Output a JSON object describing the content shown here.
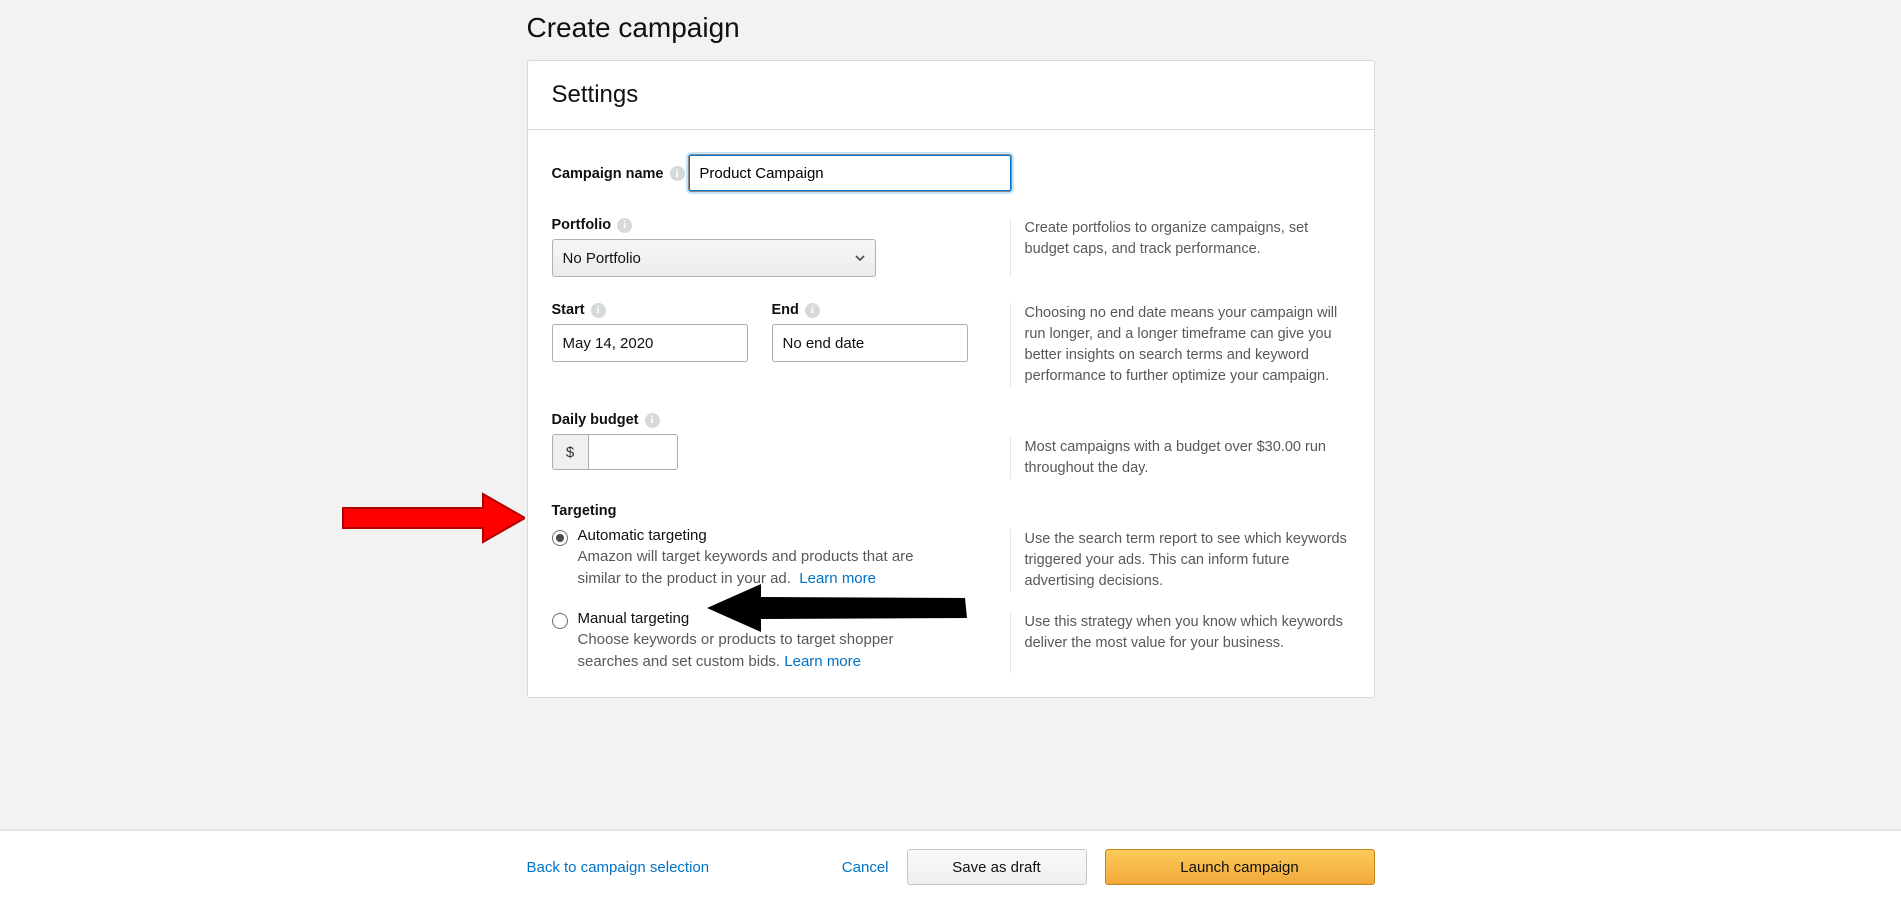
{
  "page": {
    "title": "Create campaign"
  },
  "settings": {
    "heading": "Settings",
    "campaign_name": {
      "label": "Campaign name",
      "value": "Product Campaign"
    },
    "portfolio": {
      "label": "Portfolio",
      "selected": "No Portfolio",
      "help": "Create portfolios to organize campaigns, set budget caps, and track performance."
    },
    "dates": {
      "start_label": "Start",
      "end_label": "End",
      "start_value": "May 14, 2020",
      "end_value": "No end date",
      "help": "Choosing no end date means your campaign will run longer, and a longer timeframe can give you better insights on search terms and keyword performance to further optimize your campaign."
    },
    "budget": {
      "label": "Daily budget",
      "currency": "$",
      "value": "",
      "help": "Most campaigns with a budget over $30.00 run throughout the day."
    },
    "targeting": {
      "heading": "Targeting",
      "auto": {
        "title": "Automatic targeting",
        "desc": "Amazon will target keywords and products that are similar to the product in your ad.",
        "learn_more": "Learn more",
        "help": "Use the search term report to see which keywords triggered your ads. This can inform future advertising decisions."
      },
      "manual": {
        "title": "Manual targeting",
        "desc": "Choose keywords or products to target shopper searches and set custom bids.",
        "learn_more": "Learn more",
        "help": "Use this strategy when you know which keywords deliver the most value for your business."
      }
    }
  },
  "footer": {
    "back": "Back to campaign selection",
    "cancel": "Cancel",
    "save_draft": "Save as draft",
    "launch": "Launch campaign"
  }
}
